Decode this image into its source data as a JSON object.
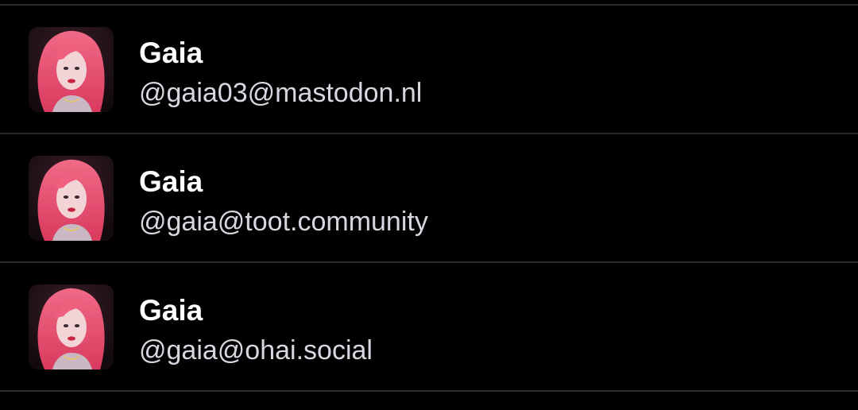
{
  "accounts": [
    {
      "display_name": "Gaia",
      "handle": "@gaia03@mastodon.nl",
      "avatar_icon": "profile-avatar"
    },
    {
      "display_name": "Gaia",
      "handle": "@gaia@toot.community",
      "avatar_icon": "profile-avatar"
    },
    {
      "display_name": "Gaia",
      "handle": "@gaia@ohai.social",
      "avatar_icon": "profile-avatar"
    }
  ],
  "colors": {
    "background": "#000000",
    "divider": "#2a2a31",
    "name_text": "#ffffff",
    "handle_text": "#d6d8e0",
    "avatar_hair": "#e8506e"
  }
}
